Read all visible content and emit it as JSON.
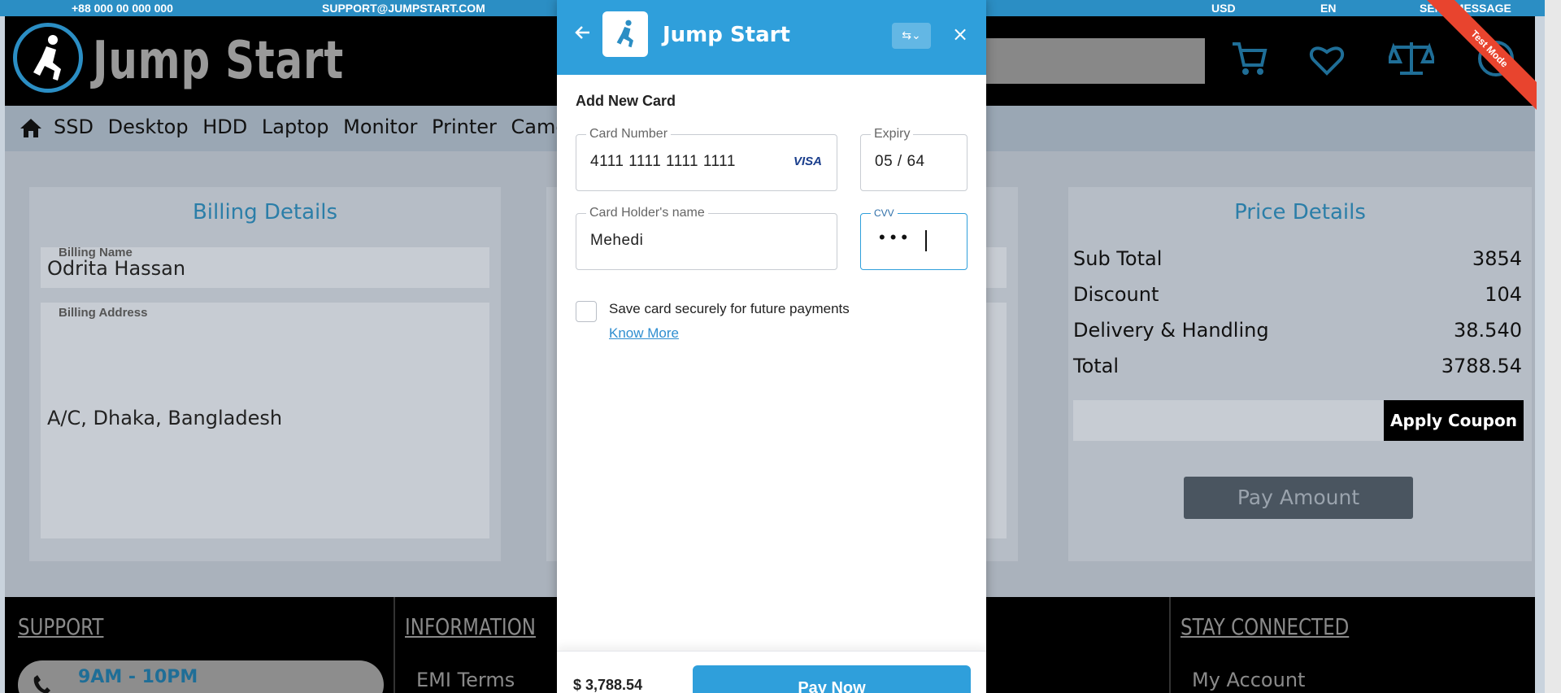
{
  "topbar": {
    "phone": "+88 000 00 000 000",
    "email": "SUPPORT@JUMPSTART.COM",
    "currency": "USD",
    "language": "EN",
    "message": "SEND MESSAGE"
  },
  "header": {
    "brand": "Jump Start"
  },
  "nav": {
    "home_icon": "home-icon",
    "items": [
      "SSD",
      "Desktop",
      "HDD",
      "Laptop",
      "Monitor",
      "Printer",
      "Camera"
    ]
  },
  "billing": {
    "title": "Billing Details",
    "name_label": "Billing Name",
    "name_value": "Odrita Hassan",
    "address_label": "Billing Address",
    "address_value": "A/C, Dhaka, Bangladesh"
  },
  "price": {
    "title": "Price Details",
    "rows": [
      {
        "label": "Sub Total",
        "value": "3854"
      },
      {
        "label": "Discount",
        "value": "104"
      },
      {
        "label": "Delivery & Handling",
        "value": "38.540"
      },
      {
        "label": "Total",
        "value": "3788.54"
      }
    ],
    "coupon_button": "Apply Coupon",
    "pay_button": "Pay Amount"
  },
  "footer": {
    "support_title": "SUPPORT",
    "hours": "9AM - 10PM",
    "info_title": "INFORMATION",
    "info_link": "EMI Terms",
    "connect_title": "STAY CONNECTED",
    "connect_link": "My Account"
  },
  "ribbon": {
    "label": "Test Mode"
  },
  "modal": {
    "title": "Jump Start",
    "lang_icon": "translate-icon",
    "section_title": "Add New Card",
    "card_number_label": "Card Number",
    "card_number_value": "4111 1111 1111 1111",
    "card_brand": "VISA",
    "expiry_label": "Expiry",
    "expiry_value": "05 / 64",
    "holder_label": "Card Holder's name",
    "holder_value": "Mehedi",
    "cvv_label": "CVV",
    "cvv_value": "•••",
    "save_card_label": "Save card securely for future payments",
    "know_more": "Know More",
    "amount": "$ 3,788.54",
    "pay_button": "Pay Now"
  },
  "colors": {
    "accent": "#2f9fdb",
    "brand_blue": "#2b8ec4",
    "ribbon": "#e8442e"
  }
}
